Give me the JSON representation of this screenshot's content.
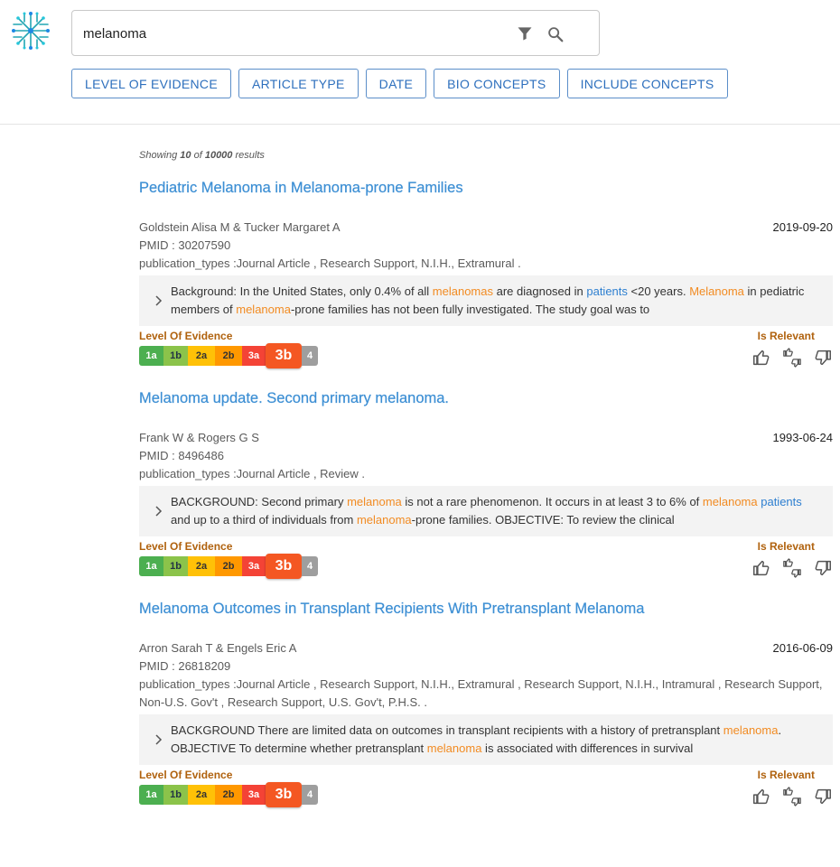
{
  "search": {
    "value": "melanoma"
  },
  "filters": [
    "LEVEL OF EVIDENCE",
    "ARTICLE TYPE",
    "DATE",
    "BIO CONCEPTS",
    "INCLUDE CONCEPTS"
  ],
  "results_info": {
    "prefix": "Showing",
    "count": "10",
    "of": "of",
    "total": "10000",
    "suffix": "results"
  },
  "labels": {
    "level_of_evidence": "Level Of Evidence",
    "is_relevant": "Is Relevant"
  },
  "evidence_levels": [
    "1a",
    "1b",
    "2a",
    "2b",
    "3a",
    "3b",
    "4"
  ],
  "colors": {
    "link": "#3d8fd4",
    "highlight_disease": "#f28b22",
    "highlight_species": "#2e7fd0",
    "label": "#b0620e"
  },
  "results": [
    {
      "title": "Pediatric Melanoma in Melanoma-prone Families",
      "authors": "Goldstein Alisa M & Tucker Margaret A",
      "date": "2019-09-20",
      "pmid": "PMID : 30207590",
      "publication_types": "publication_types :Journal Article , Research Support, N.I.H., Extramural .",
      "abstract": [
        {
          "t": "Background: In the United States, only 0.4% of all ",
          "h": ""
        },
        {
          "t": "melanomas",
          "h": "o"
        },
        {
          "t": " are diagnosed in ",
          "h": ""
        },
        {
          "t": "patients",
          "h": "b"
        },
        {
          "t": " <20 years. ",
          "h": ""
        },
        {
          "t": "Melanoma",
          "h": "o"
        },
        {
          "t": " in pediatric members of ",
          "h": ""
        },
        {
          "t": "melanoma",
          "h": "o"
        },
        {
          "t": "-prone families has not been fully investigated. The study goal was to",
          "h": ""
        }
      ],
      "level": "3b"
    },
    {
      "title": "Melanoma update. Second primary melanoma.",
      "authors": "Frank W & Rogers G S",
      "date": "1993-06-24",
      "pmid": "PMID : 8496486",
      "publication_types": "publication_types :Journal Article , Review .",
      "abstract": [
        {
          "t": "BACKGROUND: Second primary ",
          "h": ""
        },
        {
          "t": "melanoma",
          "h": "o"
        },
        {
          "t": " is not a rare phenomenon. It occurs in at least 3 to 6% of ",
          "h": ""
        },
        {
          "t": "melanoma",
          "h": "o"
        },
        {
          "t": " ",
          "h": ""
        },
        {
          "t": "patients",
          "h": "b"
        },
        {
          "t": " and up to a third of individuals from ",
          "h": ""
        },
        {
          "t": "melanoma",
          "h": "o"
        },
        {
          "t": "-prone families. OBJECTIVE: To review the clinical",
          "h": ""
        }
      ],
      "level": "3b"
    },
    {
      "title": "Melanoma Outcomes in Transplant Recipients With Pretransplant Melanoma",
      "authors": "Arron Sarah T & Engels Eric A",
      "date": "2016-06-09",
      "pmid": "PMID : 26818209",
      "publication_types": "publication_types :Journal Article , Research Support, N.I.H., Extramural , Research Support, N.I.H., Intramural , Research Support, Non-U.S. Gov't , Research Support, U.S. Gov't, P.H.S. .",
      "abstract": [
        {
          "t": "BACKGROUND There are limited data on outcomes in transplant recipients with a history of pretransplant ",
          "h": ""
        },
        {
          "t": "melanoma",
          "h": "o"
        },
        {
          "t": ". OBJECTIVE To determine whether pretransplant ",
          "h": ""
        },
        {
          "t": "melanoma",
          "h": "o"
        },
        {
          "t": " is associated with differences in survival",
          "h": ""
        }
      ],
      "level": "3b"
    }
  ]
}
